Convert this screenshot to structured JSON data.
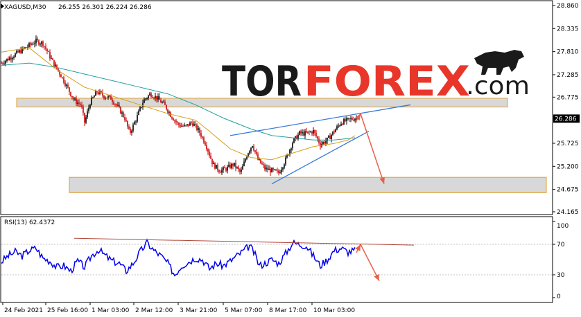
{
  "header": {
    "symbol": "XAGUSD,M30",
    "ohlc": "26.255 26.301 26.224 26.286"
  },
  "watermark": {
    "part1": "TOR",
    "part2": "FOREX",
    "part3": ".com"
  },
  "colors": {
    "bull": "#000000",
    "bear": "#cc0000",
    "ma_fast": "#d4a017",
    "ma_slow": "#20a0a0",
    "wedge": "#3a7bd5",
    "arrow": "#e8604a",
    "rsi": "#0000ee",
    "rsi_trend": "#b0473a",
    "zone_fill": "#d8d8d8",
    "zone_border": "#e0a030"
  },
  "chart_data": [
    {
      "type": "candlestick",
      "ylim": [
        24.165,
        28.86
      ],
      "yticks": [
        "28.860",
        "28.335",
        "27.810",
        "27.285",
        "26.775",
        "26.286",
        "25.725",
        "25.200",
        "24.675",
        "24.165"
      ],
      "current_price": "26.286",
      "xticks": [
        "24 Feb 2021",
        "25 Feb 16:00",
        "1 Mar 03:00",
        "2 Mar 12:00",
        "3 Mar 21:00",
        "5 Mar 07:00",
        "8 Mar 17:00",
        "10 Mar 03:00"
      ],
      "price_path": [
        [
          0,
          27.55
        ],
        [
          10,
          27.65
        ],
        [
          20,
          27.75
        ],
        [
          30,
          27.85
        ],
        [
          40,
          27.95
        ],
        [
          50,
          28.05
        ],
        [
          60,
          28.0
        ],
        [
          65,
          27.85
        ],
        [
          75,
          27.55
        ],
        [
          85,
          27.3
        ],
        [
          95,
          27.0
        ],
        [
          105,
          26.7
        ],
        [
          115,
          26.6
        ],
        [
          120,
          26.2
        ],
        [
          128,
          26.65
        ],
        [
          138,
          26.9
        ],
        [
          148,
          26.8
        ],
        [
          158,
          26.75
        ],
        [
          168,
          26.55
        ],
        [
          178,
          26.3
        ],
        [
          185,
          25.95
        ],
        [
          195,
          26.3
        ],
        [
          205,
          26.7
        ],
        [
          215,
          26.85
        ],
        [
          225,
          26.75
        ],
        [
          235,
          26.6
        ],
        [
          245,
          26.35
        ],
        [
          255,
          26.15
        ],
        [
          265,
          26.1
        ],
        [
          275,
          26.2
        ],
        [
          285,
          26.0
        ],
        [
          295,
          25.7
        ],
        [
          305,
          25.25
        ],
        [
          315,
          25.1
        ],
        [
          325,
          25.15
        ],
        [
          335,
          25.25
        ],
        [
          345,
          25.05
        ],
        [
          355,
          25.5
        ],
        [
          362,
          25.7
        ],
        [
          370,
          25.35
        ],
        [
          380,
          25.15
        ],
        [
          390,
          25.1
        ],
        [
          400,
          25.05
        ],
        [
          410,
          25.35
        ],
        [
          420,
          25.75
        ],
        [
          430,
          25.95
        ],
        [
          440,
          25.95
        ],
        [
          450,
          26.0
        ],
        [
          460,
          25.7
        ],
        [
          470,
          25.8
        ],
        [
          480,
          26.0
        ],
        [
          490,
          26.2
        ],
        [
          500,
          26.25
        ],
        [
          510,
          26.3
        ],
        [
          512,
          26.29
        ]
      ],
      "ma_fast": [
        [
          0,
          27.8
        ],
        [
          40,
          27.9
        ],
        [
          80,
          27.4
        ],
        [
          120,
          27.0
        ],
        [
          160,
          26.8
        ],
        [
          200,
          26.6
        ],
        [
          240,
          26.4
        ],
        [
          280,
          26.25
        ],
        [
          300,
          26.0
        ],
        [
          330,
          25.6
        ],
        [
          360,
          25.4
        ],
        [
          390,
          25.35
        ],
        [
          420,
          25.5
        ],
        [
          450,
          25.65
        ],
        [
          480,
          25.72
        ],
        [
          500,
          25.8
        ],
        [
          510,
          25.9
        ]
      ],
      "ma_slow": [
        [
          0,
          27.5
        ],
        [
          40,
          27.55
        ],
        [
          80,
          27.45
        ],
        [
          120,
          27.3
        ],
        [
          160,
          27.15
        ],
        [
          200,
          27.0
        ],
        [
          240,
          26.85
        ],
        [
          280,
          26.6
        ],
        [
          320,
          26.3
        ],
        [
          360,
          26.05
        ],
        [
          390,
          25.9
        ],
        [
          420,
          25.85
        ],
        [
          450,
          25.8
        ],
        [
          480,
          25.8
        ],
        [
          510,
          25.85
        ]
      ],
      "resistance_zone": [
        26.55,
        26.75
      ],
      "support_zone": [
        24.6,
        24.95
      ],
      "wedge_upper": [
        [
          330,
          25.9
        ],
        [
          590,
          26.6
        ]
      ],
      "wedge_lower": [
        [
          390,
          24.8
        ],
        [
          530,
          26.0
        ]
      ],
      "forecast_arrow": [
        [
          518,
          26.4
        ],
        [
          552,
          24.8
        ]
      ]
    },
    {
      "type": "line",
      "name": "RSI(13) 62.4372",
      "ylim": [
        0,
        100
      ],
      "yticks": [
        "100",
        "70",
        "30",
        "0"
      ],
      "rsi_path": [
        [
          0,
          47
        ],
        [
          10,
          55
        ],
        [
          20,
          60
        ],
        [
          30,
          55
        ],
        [
          40,
          62
        ],
        [
          50,
          65
        ],
        [
          60,
          52
        ],
        [
          70,
          48
        ],
        [
          80,
          40
        ],
        [
          90,
          42
        ],
        [
          100,
          35
        ],
        [
          110,
          48
        ],
        [
          120,
          40
        ],
        [
          130,
          55
        ],
        [
          140,
          63
        ],
        [
          150,
          55
        ],
        [
          160,
          48
        ],
        [
          170,
          45
        ],
        [
          180,
          35
        ],
        [
          190,
          45
        ],
        [
          200,
          60
        ],
        [
          210,
          72
        ],
        [
          220,
          62
        ],
        [
          230,
          55
        ],
        [
          240,
          45
        ],
        [
          250,
          30
        ],
        [
          260,
          42
        ],
        [
          270,
          47
        ],
        [
          280,
          52
        ],
        [
          290,
          50
        ],
        [
          300,
          38
        ],
        [
          310,
          45
        ],
        [
          320,
          42
        ],
        [
          330,
          48
        ],
        [
          340,
          55
        ],
        [
          350,
          62
        ],
        [
          358,
          68
        ],
        [
          365,
          58
        ],
        [
          372,
          42
        ],
        [
          380,
          45
        ],
        [
          390,
          50
        ],
        [
          400,
          45
        ],
        [
          410,
          58
        ],
        [
          420,
          72
        ],
        [
          430,
          70
        ],
        [
          440,
          68
        ],
        [
          450,
          55
        ],
        [
          460,
          42
        ],
        [
          470,
          50
        ],
        [
          480,
          62
        ],
        [
          490,
          65
        ],
        [
          500,
          60
        ],
        [
          510,
          62
        ]
      ],
      "trendline": [
        [
          105,
          78
        ],
        [
          595,
          69
        ]
      ],
      "forecast_arrow": [
        [
          518,
          70
        ],
        [
          545,
          22
        ]
      ]
    }
  ]
}
